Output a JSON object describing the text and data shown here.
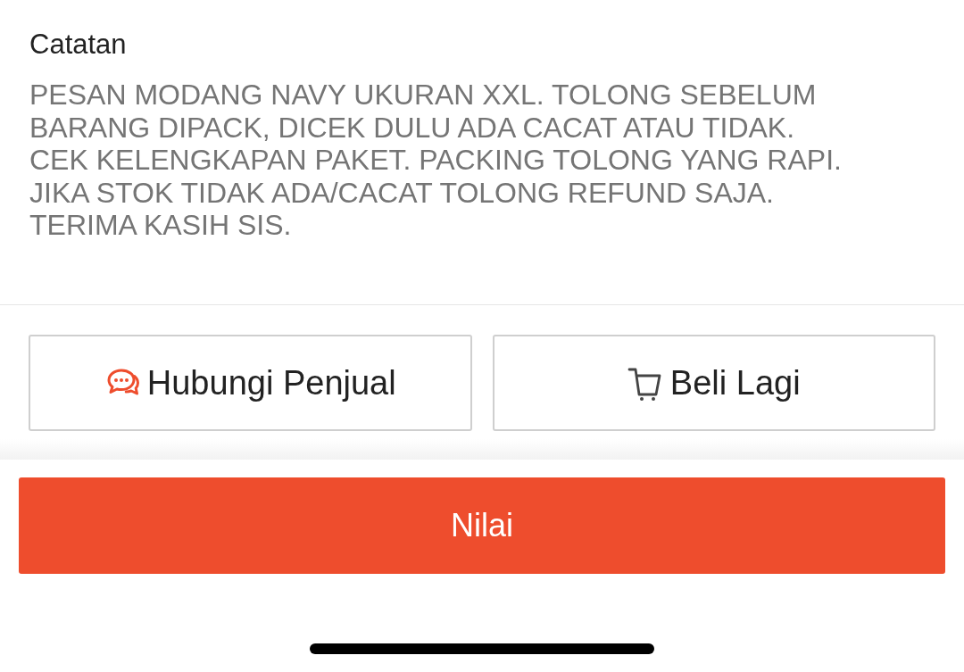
{
  "note": {
    "title": "Catatan",
    "text": "PESAN MODANG NAVY UKURAN XXL. TOLONG SEBELUM\nBARANG DIPACK, DICEK DULU ADA CACAT ATAU TIDAK.\nCEK KELENGKAPAN PAKET. PACKING TOLONG YANG RAPI.\nJIKA STOK TIDAK ADA/CACAT TOLONG REFUND SAJA.\nTERIMA KASIH SIS."
  },
  "actions": [
    {
      "label": "Hubungi Penjual",
      "kind": "chat"
    },
    {
      "label": "Beli Lagi",
      "kind": "cart"
    }
  ],
  "primary_button": {
    "label": "Nilai"
  }
}
